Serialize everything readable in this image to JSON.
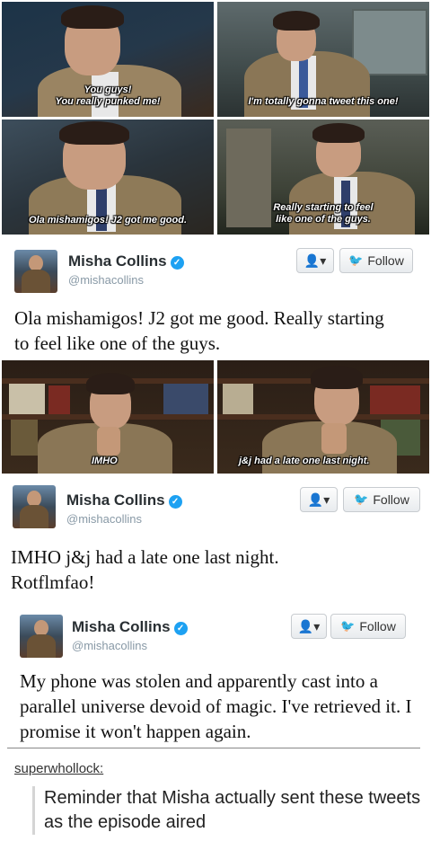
{
  "top_panels": [
    {
      "caption_lines": [
        "You guys!",
        "You really punked me!"
      ]
    },
    {
      "caption_lines": [
        "I'm totally gonna tweet this one!"
      ]
    },
    {
      "caption_lines": [
        "Ola mishamigos! J2 got me good."
      ]
    },
    {
      "caption_lines": [
        "Really starting to feel",
        "like one of the guys."
      ]
    }
  ],
  "tweets": [
    {
      "name": "Misha Collins",
      "handle": "@mishacollins",
      "follow_label": "Follow",
      "text": "Ola mishamigos! J2 got me good. Really starting to feel like one of the guys."
    },
    {
      "name": "Misha Collins",
      "handle": "@mishacollins",
      "follow_label": "Follow",
      "text": "IMHO j&j had a late one last night. Rotflmfao!"
    },
    {
      "name": "Misha Collins",
      "handle": "@mishacollins",
      "follow_label": "Follow",
      "text": "My phone was stolen and apparently cast into a parallel universe devoid of magic. I've retrieved it. I promise it won't happen again."
    }
  ],
  "mid_panels": [
    {
      "caption": "IMHO"
    },
    {
      "caption": "j&j had a late one last night."
    }
  ],
  "reblog": {
    "username": "superwhollock:",
    "quote": "Reminder that Misha actually sent these tweets as the episode aired"
  },
  "colors": {
    "verified": "#1da1f2",
    "text": "#292f33",
    "handle": "#8899a6"
  },
  "icons": {
    "verified": "verified-badge-icon",
    "follow": "twitter-bird-icon",
    "user": "user-dropdown-icon"
  }
}
